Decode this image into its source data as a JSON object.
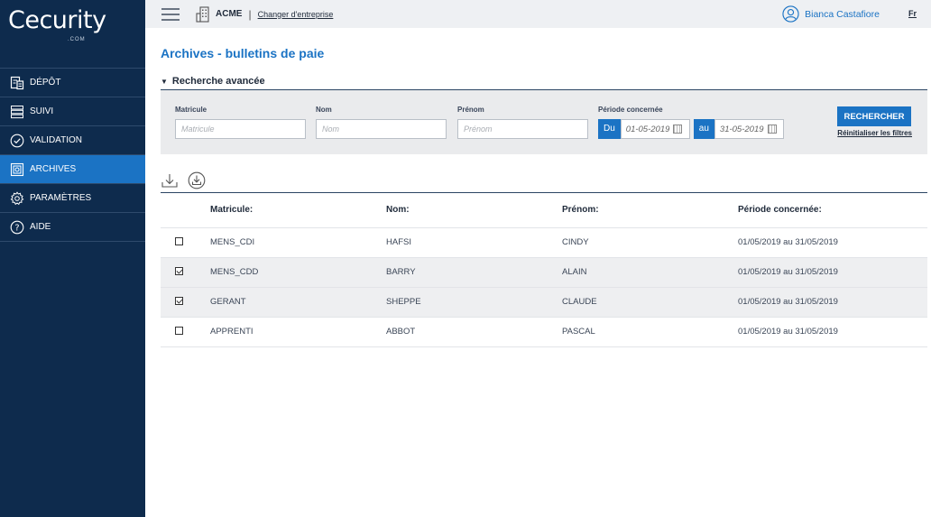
{
  "brand": {
    "logo_text": "Cecurity",
    "logo_sub": ".COM"
  },
  "sidebar": {
    "items": [
      {
        "label": "DÉPÔT",
        "icon": "deposit-icon"
      },
      {
        "label": "SUIVI",
        "icon": "list-icon"
      },
      {
        "label": "VALIDATION",
        "icon": "check-circle-icon"
      },
      {
        "label": "ARCHIVES",
        "icon": "archive-icon",
        "active": true
      },
      {
        "label": "PARAMÈTRES",
        "icon": "gear-icon"
      },
      {
        "label": "AIDE",
        "icon": "help-icon"
      }
    ]
  },
  "topbar": {
    "company": "ACME",
    "separator": "|",
    "change_company": "Changer d'entreprise",
    "user_name": "Bianca Castafiore",
    "language": "Fr"
  },
  "page": {
    "title": "Archives - bulletins de paie"
  },
  "search": {
    "header": "Recherche avancée",
    "matricule_label": "Matricule",
    "matricule_placeholder": "Matricule",
    "nom_label": "Nom",
    "nom_placeholder": "Nom",
    "prenom_label": "Prénom",
    "prenom_placeholder": "Prénom",
    "period_label": "Période concernée",
    "from_label": "Du",
    "from_value": "01-05-2019",
    "to_label": "au",
    "to_value": "31-05-2019",
    "search_button": "RECHERCHER",
    "reset_link": "Réinitialiser les filtres"
  },
  "table": {
    "headers": {
      "matricule": "Matricule:",
      "nom": "Nom:",
      "prenom": "Prénom:",
      "periode": "Période concernée:"
    },
    "rows": [
      {
        "checked": false,
        "matricule": "MENS_CDI",
        "nom": "HAFSI",
        "prenom": "CINDY",
        "periode": "01/05/2019 au 31/05/2019"
      },
      {
        "checked": true,
        "matricule": "MENS_CDD",
        "nom": "BARRY",
        "prenom": "ALAIN",
        "periode": "01/05/2019 au 31/05/2019"
      },
      {
        "checked": true,
        "matricule": "GERANT",
        "nom": "SHEPPE",
        "prenom": "CLAUDE",
        "periode": "01/05/2019 au 31/05/2019"
      },
      {
        "checked": false,
        "matricule": "APPRENTI",
        "nom": "ABBOT",
        "prenom": "PASCAL",
        "periode": "01/05/2019 au 31/05/2019"
      }
    ]
  },
  "colors": {
    "sidebar_bg": "#0e2b4d",
    "accent": "#1b73c4",
    "topbar_bg": "#eef0f3",
    "filter_bg": "#eaebed"
  }
}
